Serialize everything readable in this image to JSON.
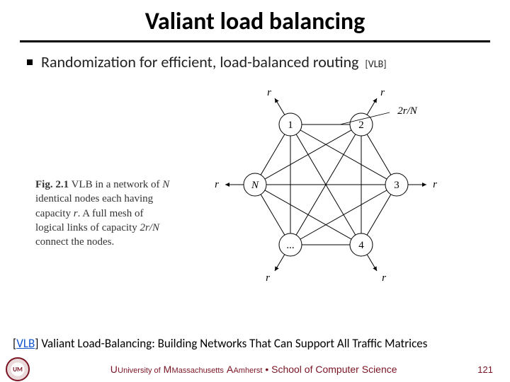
{
  "title": "Valiant load balancing",
  "bullet": {
    "text": "Randomization for efficient, load-balanced routing",
    "cite": "[VLB]"
  },
  "figure": {
    "caption_figno": "Fig. 2.1",
    "caption_rest_1": " VLB in a network of ",
    "caption_N": "N",
    "caption_rest_2": " identical nodes each having capacity ",
    "caption_r": "r",
    "caption_rest_3": ". A full mesh of logical links of capacity ",
    "caption_cap": "2r/N",
    "caption_rest_4": " connect the nodes.",
    "node_labels": [
      "1",
      "2",
      "3",
      "4",
      "...",
      "N"
    ],
    "edge_label_top": "2r/N",
    "r_label": "r"
  },
  "reference": {
    "link": "VLB",
    "rest": " Valiant Load-Balancing: Building Networks That Can Support All Traffic Matrices"
  },
  "footer": {
    "univ1": "University of",
    "univ2": "Massachusetts",
    "univ3": "Amherst",
    "sep": " • ",
    "school": "School of Computer Science",
    "page": "121",
    "seal": "UM"
  }
}
